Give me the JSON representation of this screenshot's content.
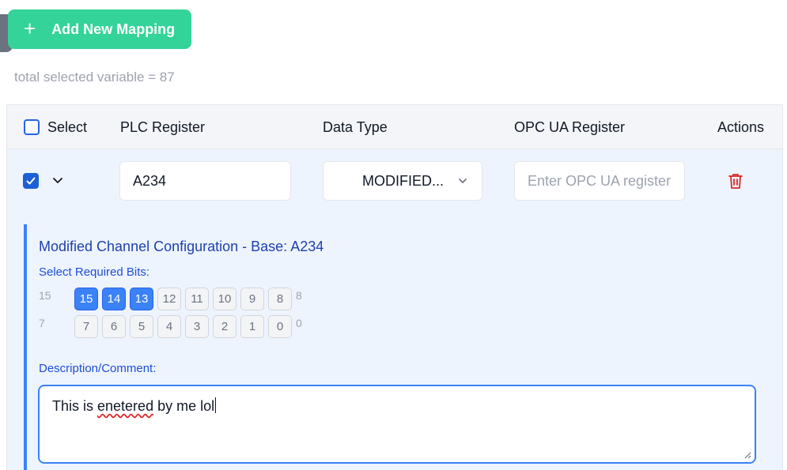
{
  "toolbar": {
    "add_label": "Add New Mapping",
    "add_icon": "plus-icon"
  },
  "summary": {
    "total_text": "total selected variable = 87"
  },
  "table": {
    "headers": {
      "select": "Select",
      "plc": "PLC Register",
      "data_type": "Data Type",
      "opc": "OPC UA Register",
      "actions": "Actions"
    },
    "rows": [
      {
        "checked": true,
        "plc_register": "A234",
        "data_type": "MODIFIED...",
        "opc_placeholder": "Enter OPC UA register",
        "action_icon": "trash-icon"
      }
    ]
  },
  "config": {
    "title": "Modified Channel Configuration - Base: A234",
    "bits_label": "Select Required Bits:",
    "row_high": {
      "start": "15",
      "end": "8",
      "bits": [
        "15",
        "14",
        "13",
        "12",
        "11",
        "10",
        "9",
        "8"
      ],
      "selected": [
        "15",
        "14",
        "13"
      ]
    },
    "row_low": {
      "start": "7",
      "end": "0",
      "bits": [
        "7",
        "6",
        "5",
        "4",
        "3",
        "2",
        "1",
        "0"
      ],
      "selected": []
    },
    "desc_label": "Description/Comment:",
    "desc_pre": "This is ",
    "desc_misspelled": "enetered",
    "desc_post": " by me lol"
  },
  "colors": {
    "accent": "#34d399",
    "primary": "#3b82f6",
    "danger": "#dc2626"
  }
}
